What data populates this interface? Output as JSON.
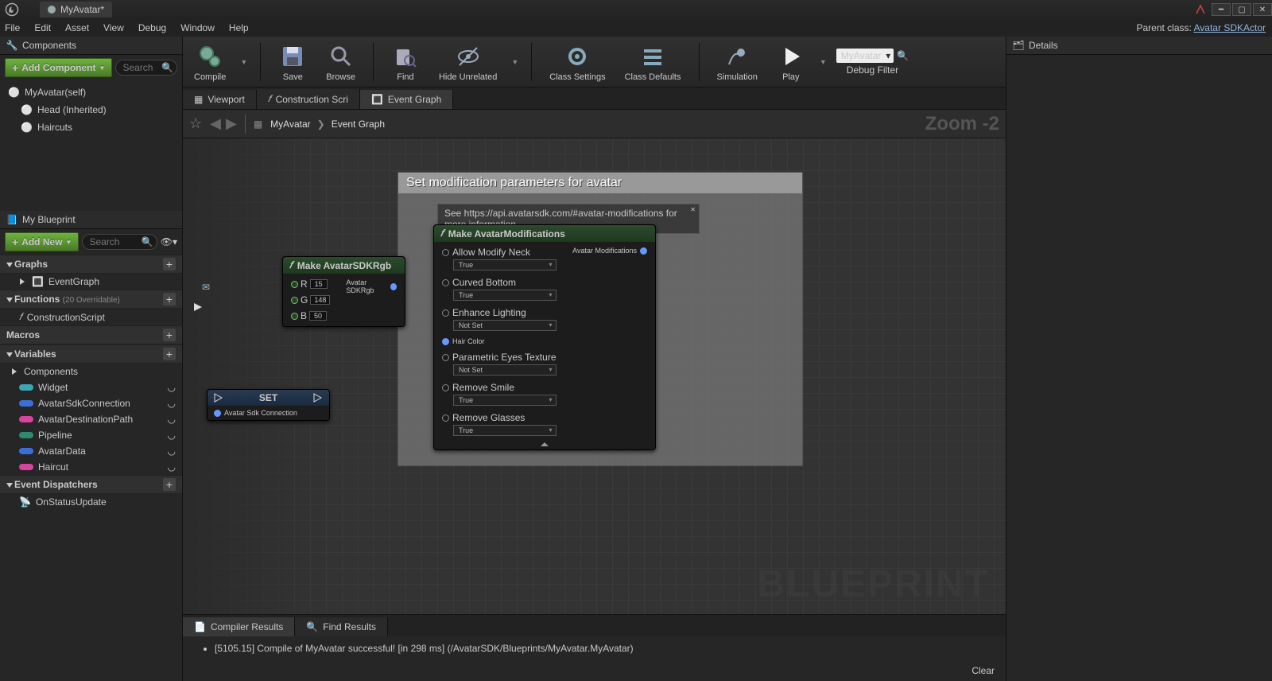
{
  "titlebar": {
    "tab": "MyAvatar*"
  },
  "menu": [
    "File",
    "Edit",
    "Asset",
    "View",
    "Debug",
    "Window",
    "Help"
  ],
  "parent_class": {
    "label": "Parent class:",
    "link": "Avatar SDKActor"
  },
  "components_panel": {
    "title": "Components",
    "add_button": "Add Component",
    "search_placeholder": "Search",
    "items": [
      {
        "label": "MyAvatar(self)"
      },
      {
        "label": "Head (Inherited)"
      },
      {
        "label": "Haircuts"
      }
    ]
  },
  "myblueprint": {
    "title": "My Blueprint",
    "add_button": "Add New",
    "search_placeholder": "Search",
    "sections": {
      "graphs": {
        "title": "Graphs",
        "items": [
          "EventGraph"
        ]
      },
      "functions": {
        "title": "Functions",
        "hint": "(20 Overridable)",
        "items": [
          "ConstructionScript"
        ]
      },
      "macros": {
        "title": "Macros"
      },
      "variables": {
        "title": "Variables",
        "sub": "Components",
        "items": [
          {
            "name": "Widget",
            "color": "#3ba6b5"
          },
          {
            "name": "AvatarSdkConnection",
            "color": "#3a6fd8"
          },
          {
            "name": "AvatarDestinationPath",
            "color": "#d843a0"
          },
          {
            "name": "Pipeline",
            "color": "#2e8a6f"
          },
          {
            "name": "AvatarData",
            "color": "#3a6fd8"
          },
          {
            "name": "Haircut",
            "color": "#d843a0"
          }
        ]
      },
      "dispatchers": {
        "title": "Event Dispatchers",
        "items": [
          "OnStatusUpdate"
        ]
      }
    }
  },
  "toolbar": [
    {
      "label": "Compile",
      "icon": "gears"
    },
    {
      "label": "Save",
      "icon": "floppy"
    },
    {
      "label": "Browse",
      "icon": "mag"
    },
    {
      "label": "Find",
      "icon": "find"
    },
    {
      "label": "Hide Unrelated",
      "icon": "eyeline"
    },
    {
      "label": "Class Settings",
      "icon": "gear"
    },
    {
      "label": "Class Defaults",
      "icon": "sliders"
    },
    {
      "label": "Simulation",
      "icon": "bounce"
    },
    {
      "label": "Play",
      "icon": "play"
    }
  ],
  "debug_filter": {
    "label": "Debug Filter",
    "value": "MyAvatar"
  },
  "graph_tabs": [
    "Viewport",
    "Construction Scri",
    "Event Graph"
  ],
  "breadcrumb": {
    "a": "MyAvatar",
    "b": "Event Graph",
    "zoom": "Zoom -2"
  },
  "watermark": "BLUEPRINT",
  "comment": {
    "title": "Set modification parameters for avatar",
    "info": "See https://api.avatarsdk.com/#avatar-modifications for more information"
  },
  "node_rgb": {
    "title": "Make AvatarSDKRgb",
    "out": "Avatar SDKRgb",
    "inputs": [
      {
        "k": "R",
        "v": "15"
      },
      {
        "k": "G",
        "v": "148"
      },
      {
        "k": "B",
        "v": "50"
      }
    ]
  },
  "node_set": {
    "title": "SET",
    "pin": "Avatar Sdk Connection"
  },
  "node_mods": {
    "title": "Make AvatarModifications",
    "out": "Avatar Modifications",
    "rows": [
      {
        "label": "Allow Modify Neck",
        "value": "True"
      },
      {
        "label": "Curved Bottom",
        "value": "True"
      },
      {
        "label": "Enhance Lighting",
        "value": "Not Set"
      },
      {
        "label": "Hair Color",
        "value": null
      },
      {
        "label": "Parametric Eyes Texture",
        "value": "Not Set"
      },
      {
        "label": "Remove Smile",
        "value": "True"
      },
      {
        "label": "Remove Glasses",
        "value": "True"
      }
    ]
  },
  "bottom": {
    "tabs": [
      "Compiler Results",
      "Find Results"
    ],
    "line": "[5105.15] Compile of MyAvatar successful! [in 298 ms] (/AvatarSDK/Blueprints/MyAvatar.MyAvatar)",
    "clear": "Clear"
  },
  "details": {
    "title": "Details"
  }
}
